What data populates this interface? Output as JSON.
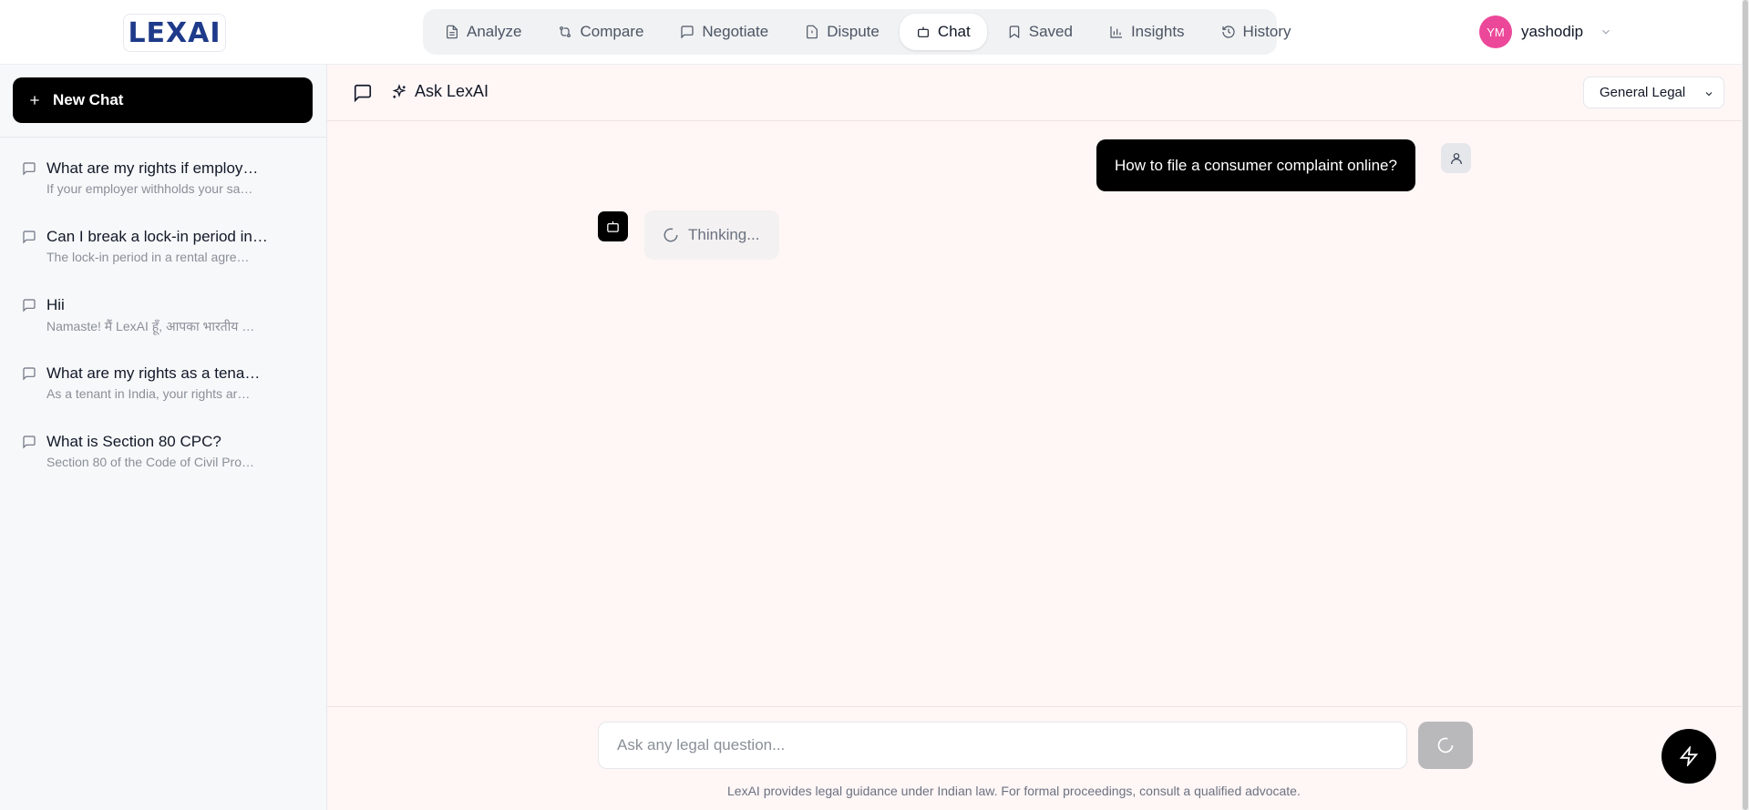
{
  "brand": {
    "logo_text": "LEXAI"
  },
  "nav": {
    "items": [
      {
        "label": "Analyze",
        "icon": "file-text-icon",
        "active": false
      },
      {
        "label": "Compare",
        "icon": "git-compare-icon",
        "active": false
      },
      {
        "label": "Negotiate",
        "icon": "message-square-icon",
        "active": false
      },
      {
        "label": "Dispute",
        "icon": "file-alert-icon",
        "active": false
      },
      {
        "label": "Chat",
        "icon": "bot-icon",
        "active": true
      },
      {
        "label": "Saved",
        "icon": "bookmark-icon",
        "active": false
      },
      {
        "label": "Insights",
        "icon": "bar-chart-icon",
        "active": false
      },
      {
        "label": "History",
        "icon": "history-icon",
        "active": false
      }
    ]
  },
  "user": {
    "initials": "YM",
    "name": "yashodip",
    "avatar_color": "#ec4899"
  },
  "sidebar": {
    "new_chat_label": "New Chat",
    "history": [
      {
        "title": "What are my rights if employ…",
        "snippet": "If your employer withholds your sa…"
      },
      {
        "title": "Can I break a lock-in period in…",
        "snippet": "The lock-in period in a rental agre…"
      },
      {
        "title": "Hii",
        "snippet": "Namaste! मैं LexAI हूँ, आपका भारतीय …"
      },
      {
        "title": "What are my rights as a tena…",
        "snippet": "As a tenant in India, your rights ar…"
      },
      {
        "title": "What is Section 80 CPC?",
        "snippet": "Section 80 of the Code of Civil Pro…"
      }
    ]
  },
  "chat": {
    "title": "Ask LexAI",
    "mode_selected": "General Legal",
    "messages": [
      {
        "role": "user",
        "text": "How to file a consumer complaint online?"
      },
      {
        "role": "assistant",
        "text": "Thinking..."
      }
    ],
    "input_placeholder": "Ask any legal question...",
    "input_value": "",
    "disclaimer": "LexAI provides legal guidance under Indian law. For formal proceedings, consult a qualified advocate."
  },
  "colors": {
    "accent": "#000000",
    "main_bg": "#fff6f6",
    "sidebar_bg": "#f7f8fa",
    "send_disabled": "#b9b9bb"
  }
}
